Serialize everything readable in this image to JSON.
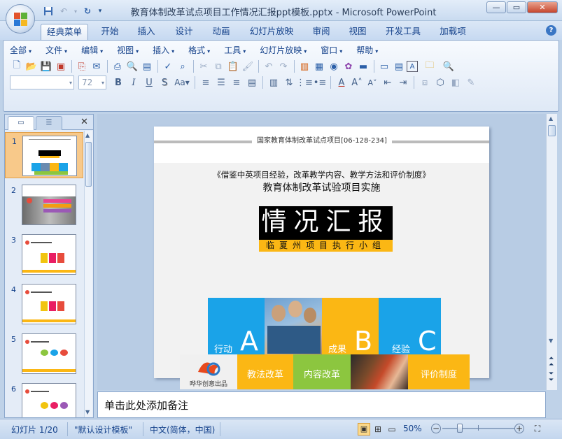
{
  "window": {
    "title": "教育体制改革试点项目工作情况汇报ppt模板.pptx - Microsoft PowerPoint"
  },
  "ribbon_tabs": [
    "经典菜单",
    "开始",
    "插入",
    "设计",
    "动画",
    "幻灯片放映",
    "审阅",
    "视图",
    "开发工具",
    "加载项"
  ],
  "classic_menu": [
    "全部",
    "文件",
    "编辑",
    "视图",
    "插入",
    "格式",
    "工具",
    "幻灯片放映",
    "窗口",
    "帮助"
  ],
  "font_size": "72",
  "slide_panel": {
    "numbers": [
      "1",
      "2",
      "3",
      "4",
      "5",
      "6"
    ],
    "selected": "1"
  },
  "slide": {
    "header": "国家教育体制改革试点项目[06-128-234]",
    "subtitle1": "《借鉴中英项目经验，改革教学内容、教学方法和评价制度》",
    "subtitle2": "教育体制改革试验项目实施",
    "main_title": "情况汇报",
    "group": "临夏州项目执行小组",
    "blocks": [
      {
        "label": "行动",
        "letter": "A"
      },
      {
        "label": "成果",
        "letter": "B"
      },
      {
        "label": "经验",
        "letter": "C"
      }
    ],
    "bottom_boxes": [
      "教法改革",
      "内容改革",
      "评价制度"
    ],
    "logo_text": "哗华创意出品"
  },
  "notes_placeholder": "单击此处添加备注",
  "status": {
    "slide_info": "幻灯片 1/20",
    "theme": "\"默认设计模板\"",
    "language": "中文(简体，中国)",
    "zoom": "50%"
  },
  "colors": {
    "blue": "#1aa3e8",
    "yellow": "#fbb714",
    "green": "#8cc63f",
    "black": "#000000"
  }
}
